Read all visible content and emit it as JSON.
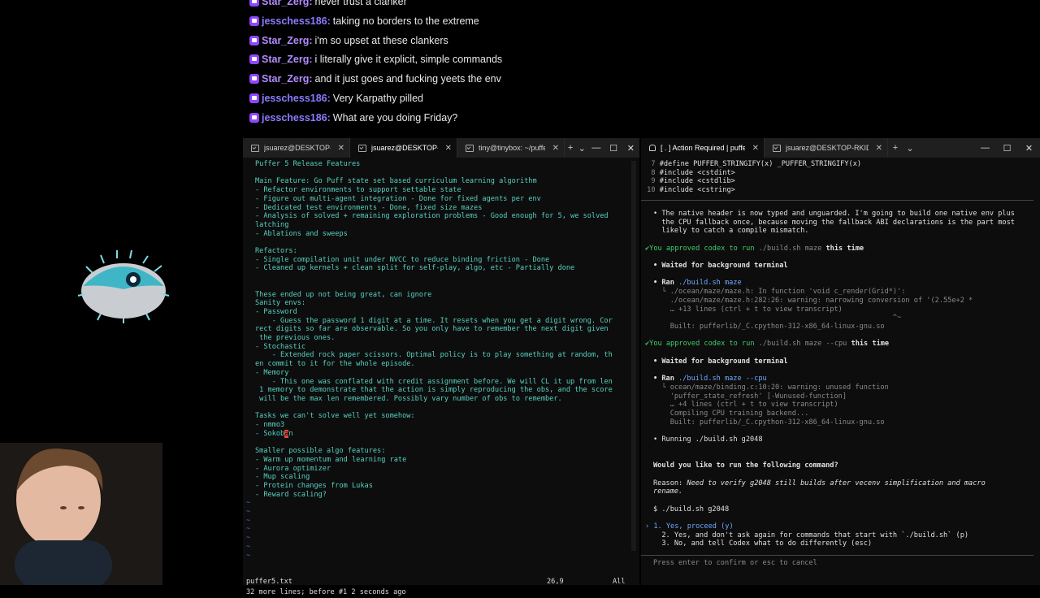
{
  "chat": [
    {
      "user": "Star_Zerg",
      "message": "never trust a clanker"
    },
    {
      "user": "jesschess186",
      "message": "taking no borders to the extreme"
    },
    {
      "user": "Star_Zerg",
      "message": "i'm so upset at these clankers"
    },
    {
      "user": "Star_Zerg",
      "message": "i literally give it explicit, simple commands"
    },
    {
      "user": "Star_Zerg",
      "message": "and it just goes and fucking yeets the env"
    },
    {
      "user": "jesschess186",
      "message": "Very Karpathy pilled"
    },
    {
      "user": "jesschess186",
      "message": "What are you doing Friday?"
    }
  ],
  "left_window": {
    "tabs": [
      {
        "label": "jsuarez@DESKTOP-RKI",
        "active": false,
        "icon": "terminal-icon"
      },
      {
        "label": "jsuarez@DESKTOP-RKI",
        "active": true,
        "icon": "terminal-icon"
      },
      {
        "label": "tiny@tinybox: ~/puffer",
        "active": false,
        "icon": "terminal-icon"
      }
    ],
    "new_tab": "+",
    "dropdown": "⌄",
    "controls": {
      "minimize": "—",
      "maximize": "☐",
      "close": "✕"
    },
    "lines": [
      "Puffer 5 Release Features",
      "",
      "Main Feature: Go Puff state set based curriculum learning algorithm",
      "- Refactor environments to support settable state",
      "- Figure out multi-agent integration - Done for fixed agents per env",
      "- Dedicated test environments - Done, fixed size mazes",
      "- Analysis of solved + remaining exploration problems - Good enough for 5, we solved",
      "latching",
      "- Ablations and sweeps",
      "",
      "Refactors:",
      "- Single compilation unit under NVCC to reduce binding friction - Done",
      "- Cleaned up kernels + clean split for self-play, algo, etc - Partially done",
      "",
      "",
      "These ended up not being great, can ignore",
      "Sanity envs:",
      "- Password",
      "    - Guess the password 1 digit at a time. It resets when you get a digit wrong. Cor",
      "rect digits so far are observable. So you only have to remember the next digit given",
      " the previous ones.",
      "- Stochastic",
      "    - Extended rock paper scissors. Optimal policy is to play something at random, th",
      "en commit to it for the whole episode.",
      "- Memory",
      "    - This one was conflated with credit assignment before. We will CL it up from len",
      " 1 memory to demonstrate that the action is simply reproducing the obs, and the score",
      " will be the max len remembered. Possibly vary number of obs to remember.",
      "",
      "Tasks we can't solve well yet somehow:",
      "- nmmo3",
      "- Sokoban",
      "",
      "Smaller possible algo features:",
      "- Warm up momentum and learning rate",
      "- Aurora optimizer",
      "- Mup scaling",
      "- Protein changes from Lukas",
      "- Reward scaling?"
    ],
    "tilde": "~",
    "status_file": "puffer5.txt",
    "status_pos": "26,9",
    "status_all": "All",
    "message": "32 more lines; before #1  2 seconds ago"
  },
  "right_window": {
    "tabs": [
      {
        "label": "[ . ] Action Required | pufferlil",
        "active": true,
        "icon": "bell-icon"
      },
      {
        "label": "jsuarez@DESKTOP-RKIDMSJ: ~",
        "active": false,
        "icon": "terminal-icon"
      }
    ],
    "new_tab": "+",
    "dropdown": "⌄",
    "controls": {
      "minimize": "—",
      "maximize": "☐",
      "close": "✕"
    },
    "code_lines": [
      {
        "num": "7",
        "text": "#define PUFFER_STRINGIFY(x) _PUFFER_STRINGIFY(x)"
      },
      {
        "num": "8",
        "text": "#include <cstdint>"
      },
      {
        "num": "9",
        "text": "#include <cstdlib>"
      },
      {
        "num": "10",
        "text": "#include <cstring>"
      }
    ],
    "para1": [
      "• The native header is now typed and unguarded. I'm going to build one native env plus",
      "  the CPU fallback once, because moving the fallback ABI declarations is the part most",
      "  likely to catch a compile mismatch."
    ],
    "approve1_prefix": "✔You approved codex to run ",
    "approve1_cmd": "./build.sh maze",
    "approve1_suffix": " this time",
    "wait1": "• Waited for background terminal",
    "ran1_prefix": "• Ran ",
    "ran1_cmd": "./build.sh maze",
    "ran1_out": [
      "  └ ./ocean/maze/maze.h: In function 'void c_render(Grid*)':",
      "    ./ocean/maze/maze.h:282:26: warning: narrowing conversion of '(2.55e+2 *",
      "    … +13 lines (ctrl + t to view transcript)",
      "                                                         ^~",
      "    Built: pufferlib/_C.cpython-312-x86_64-linux-gnu.so"
    ],
    "approve2_prefix": "✔You approved codex to run ",
    "approve2_cmd": "./build.sh maze --cpu",
    "approve2_suffix": " this time",
    "wait2": "• Waited for background terminal",
    "ran2_prefix": "• Ran ",
    "ran2_cmd": "./build.sh maze --cpu",
    "ran2_out": [
      "  └ ocean/maze/binding.c:10:20: warning: unused function",
      "    'puffer_state_refresh' [-Wunused-function]",
      "    … +4 lines (ctrl + t to view transcript)",
      "    Compiling CPU training backend...",
      "    Built: pufferlib/_C.cpython-312-x86_64-linux-gnu.so"
    ],
    "running_prefix": "• Running ",
    "running_cmd": "./build.sh g2048",
    "question": "Would you like to run the following command?",
    "reason_label": "Reason: ",
    "reason_text": "Need to verify g2048 still builds after vecenv simplification and macro",
    "reason_text2": "rename.",
    "command": "$ ./build.sh g2048",
    "option1": "› 1. Yes, proceed (y)",
    "option2": "  2. Yes, and don't ask again for commands that start with `./build.sh` (p)",
    "option3": "  3. No, and tell Codex what to do differently (esc)",
    "footer": "Press enter to confirm or esc to cancel"
  },
  "colors": {
    "vim_text": "#58d1c2",
    "tilde": "#4a6fd1",
    "cursor": "#e0483b",
    "chat_user": "#8a7bff"
  }
}
